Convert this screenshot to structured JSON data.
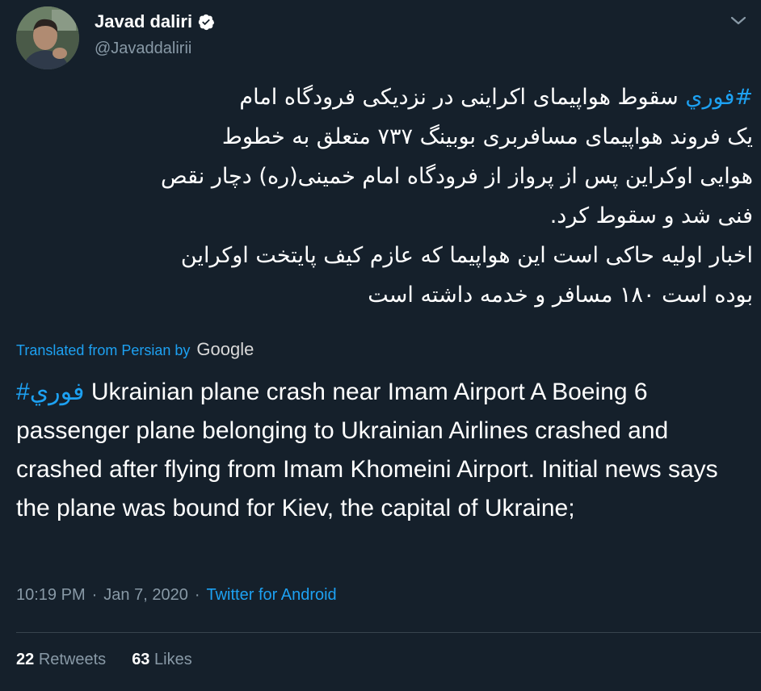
{
  "user": {
    "display_name": "Javad daliri",
    "handle": "@Javaddalirii",
    "verified": true,
    "avatar_icon": "profile-photo"
  },
  "tweet": {
    "persian_hashtag": "#فوري",
    "persian_lines": [
      "سقوط هواپیمای اکراینی در نزدیکی فرودگاه امام",
      "یک فروند هواپیمای مسافربری بوبینگ ۷۳۷ متعلق به خطوط",
      "هوایی اوکراین پس از پرواز از فرودگاه امام خمینی(ره) دچار نقص",
      "فنی شد و سقوط کرد.",
      "اخبار اولیه حاکی است این هواپیما که عازم کیف پایتخت اوکراین",
      "بوده است ۱۸۰ مسافر و خدمه داشته است"
    ],
    "translated_label": "Translated from Persian by",
    "translator": "Google",
    "english_hashtag": "#فوري",
    "english_text": " Ukrainian plane crash near Imam Airport A Boeing 6 passenger plane belonging to Ukrainian Airlines crashed and crashed after flying from Imam Khomeini Airport. Initial news says the plane was bound for Kiev, the capital of Ukraine;",
    "time": "10:19 PM",
    "separator": "·",
    "date": "Jan 7, 2020",
    "source": "Twitter for Android"
  },
  "stats": {
    "retweets_count": "22",
    "retweets_label": "Retweets",
    "likes_count": "63",
    "likes_label": "Likes"
  },
  "colors": {
    "background": "#15202b",
    "accent": "#1da1f2",
    "muted": "#8899a6"
  }
}
